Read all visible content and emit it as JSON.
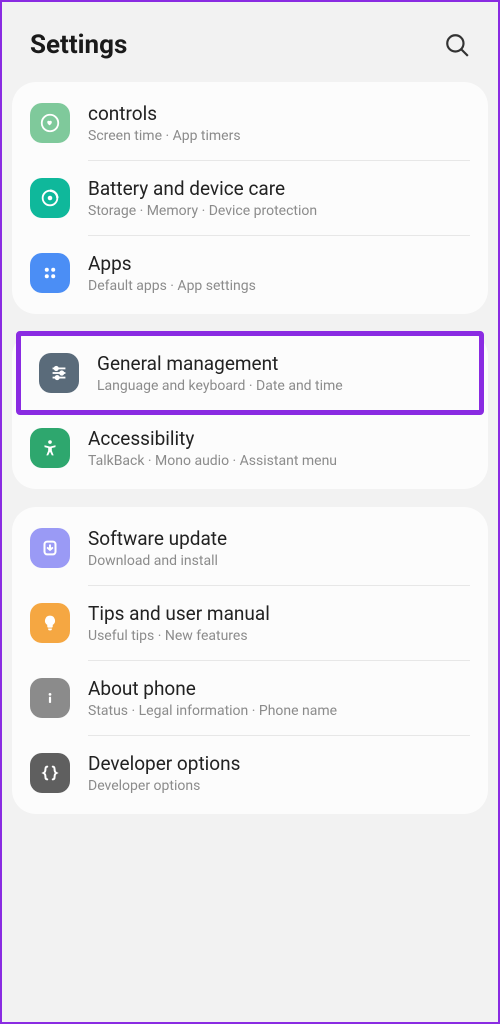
{
  "header": {
    "title": "Settings"
  },
  "groups": [
    {
      "items": [
        {
          "id": "controls",
          "title": "controls",
          "sub": "Screen time  ·  App timers"
        },
        {
          "id": "battery",
          "title": "Battery and device care",
          "sub": "Storage  ·  Memory  ·  Device protection"
        },
        {
          "id": "apps",
          "title": "Apps",
          "sub": "Default apps  ·  App settings"
        }
      ]
    },
    {
      "items": [
        {
          "id": "general",
          "title": "General management",
          "sub": "Language and keyboard  ·  Date and time",
          "highlighted": true
        },
        {
          "id": "accessibility",
          "title": "Accessibility",
          "sub": "TalkBack  ·  Mono audio  ·  Assistant menu"
        }
      ]
    },
    {
      "items": [
        {
          "id": "software",
          "title": "Software update",
          "sub": "Download and install"
        },
        {
          "id": "tips",
          "title": "Tips and user manual",
          "sub": "Useful tips  ·  New features"
        },
        {
          "id": "about",
          "title": "About phone",
          "sub": "Status  ·  Legal information  ·  Phone name"
        },
        {
          "id": "developer",
          "title": "Developer options",
          "sub": "Developer options"
        }
      ]
    }
  ]
}
